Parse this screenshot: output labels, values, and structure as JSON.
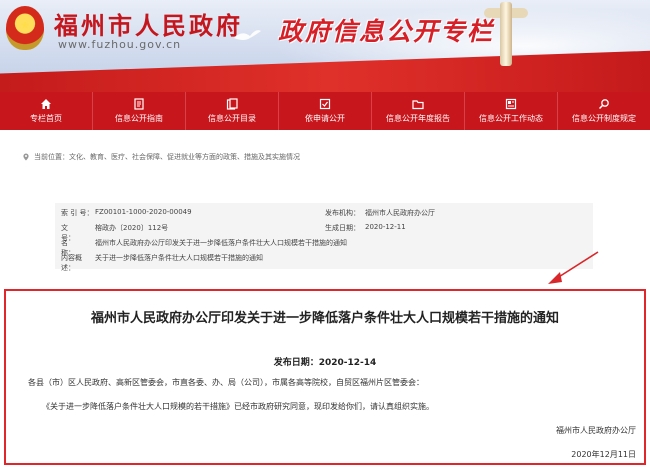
{
  "header": {
    "emblem_glyph": "★",
    "site_title": "福州市人民政府",
    "site_url": "www.fuzhou.gov.cn",
    "zone_title": "政府信息公开专栏"
  },
  "nav": {
    "items": [
      {
        "label": "专栏首页",
        "icon": "home-icon"
      },
      {
        "label": "信息公开指南",
        "icon": "book-icon"
      },
      {
        "label": "信息公开目录",
        "icon": "catalog-icon"
      },
      {
        "label": "依申请公开",
        "icon": "apply-icon"
      },
      {
        "label": "信息公开年度报告",
        "icon": "folder-icon"
      },
      {
        "label": "信息公开工作动态",
        "icon": "news-icon"
      },
      {
        "label": "信息公开制度规定",
        "icon": "search-icon"
      }
    ]
  },
  "breadcrumb": {
    "prefix": "当前位置：",
    "path": [
      "文化、教育、医疗、社会保障、促进就业等方面的政策、措施及其实施情况"
    ]
  },
  "meta": {
    "index_key": "索 引 号：",
    "index_val": "FZ00101-1000-2020-00049",
    "doc_key": "文　　号：",
    "doc_val": "榕政办〔2020〕112号",
    "name_key": "名　　称：",
    "name_val": "福州市人民政府办公厅印发关于进一步降低落户条件壮大人口规模若干措施的通知",
    "summary_key": "内容概述：",
    "summary_val": "关于进一步降低落户条件壮大人口规模若干措施的通知",
    "issuer_key": "发布机构：",
    "issuer_val": "福州市人民政府办公厅",
    "gen_key": "生成日期：",
    "gen_val": "2020-12-11"
  },
  "article": {
    "title": "福州市人民政府办公厅印发关于进一步降低落户条件壮大人口规模若干措施的通知",
    "pub_date": "发布日期：2020-12-14",
    "salutation": "各县（市）区人民政府、高新区管委会，市直各委、办、局（公司），市属各高等院校，自贸区福州片区管委会：",
    "body": "《关于进一步降低落户条件壮大人口规模的若干措施》已经市政府研究同意，现印发给你们，请认真组织实施。",
    "sign_org": "福州市人民政府办公厅",
    "sign_date": "2020年12月11日"
  },
  "colors": {
    "nav_bg": "#c8161d",
    "accent_red": "#e0262a",
    "meta_bg": "#f4f4f4"
  }
}
